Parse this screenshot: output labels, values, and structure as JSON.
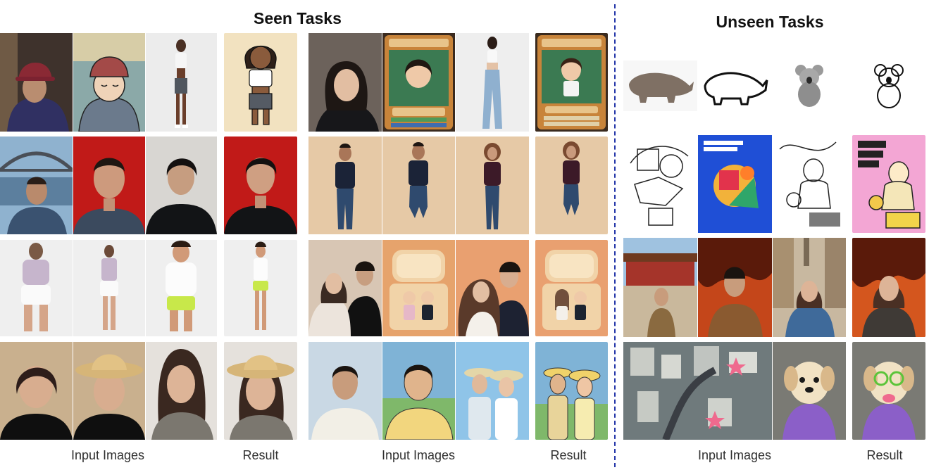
{
  "titles": {
    "seen": "Seen Tasks",
    "unseen": "Unseen Tasks"
  },
  "captions": {
    "seen_left_input": "Input Images",
    "seen_left_result": "Result",
    "seen_right_input": "Input Images",
    "seen_right_result": "Result",
    "unseen_input": "Input Images",
    "unseen_result": "Result"
  },
  "colors": {
    "divider": "#2335a8",
    "title": "#111111",
    "caption": "#303030",
    "background": "#ffffff"
  },
  "images": {
    "seen_left": [
      [
        "elderly-woman-photo",
        "elderly-woman-cartoon",
        "woman-full-body-photo",
        "woman-cartoon-result"
      ],
      [
        "man-bridge-selfie",
        "man-red-background-portrait",
        "man-dark-shirt-portrait",
        "man-red-background-result"
      ],
      [
        "woman-lavender-outfit",
        "woman-lavender-outfit-slim",
        "man-white-shirt-green-shorts",
        "man-slim-result"
      ],
      [
        "woman-dark-hair-portrait",
        "woman-straw-hat-portrait",
        "woman-long-hair-portrait",
        "woman-straw-hat-result"
      ]
    ],
    "seen_right": [
      [
        "woman-smiling-portrait",
        "programmer-card-cartoon",
        "woman-jeans-full-body",
        "programmer-card-result"
      ],
      [
        "man-standing-navy-tshirt",
        "man-jumping-navy-tshirt",
        "woman-standing-maroon-tshirt",
        "woman-jumping-result"
      ],
      [
        "couple-portrait",
        "forever-together-toy-box",
        "couple-smiling-portrait",
        "toy-box-result"
      ],
      [
        "man-white-tshirt",
        "man-cartoon-anime",
        "couple-sunhats-selfie",
        "couple-cartoon-result"
      ]
    ],
    "unseen": [
      [
        "rhinoceros-photo",
        "rhinoceros-line-drawing",
        "koala-photo",
        "koala-line-drawing-result"
      ],
      [
        "line-art-collage",
        "geometric-illustration-poster",
        "line-art-cooking-woman",
        "art-chalk-colored-result"
      ],
      [
        "man-forbidden-city",
        "man-fire-background",
        "woman-european-street",
        "woman-fire-background-result"
      ],
      [
        "aerial-city-with-starfish",
        "puppy-purple-shirt",
        "puppy-glasses-result"
      ]
    ]
  }
}
